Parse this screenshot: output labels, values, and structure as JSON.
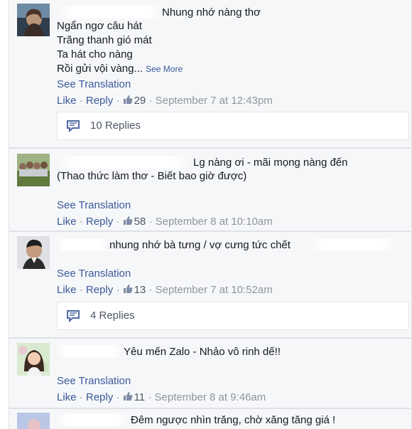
{
  "see_translation": "See Translation",
  "comments": [
    {
      "lines": [
        "Nhung nhớ nàng thơ",
        "Ngẩn ngơ câu hát",
        "Trăng thanh gió mát",
        "Ta hát cho nàng",
        "Rồi gửi vội vàng..."
      ],
      "see_more": "See More",
      "like": "Like",
      "reply": "Reply",
      "likes": "29",
      "time": "September 7 at 12:43pm",
      "replies": "10 Replies"
    },
    {
      "lines": [
        "Lg nàng ơi - mãi mọng nàng đến",
        "(Thao thức làm thơ - Biết bao giờ được)"
      ],
      "like": "Like",
      "reply": "Reply",
      "likes": "58",
      "time": "September 8 at 10:10am"
    },
    {
      "lines": [
        "nhung nhớ bà tưng / vợ cưng tức chết"
      ],
      "like": "Like",
      "reply": "Reply",
      "likes": "13",
      "time": "September 7 at 10:52am",
      "replies": "4 Replies"
    },
    {
      "lines": [
        "Yêu mến Zalo - Nhảo vô rinh dế!!"
      ],
      "like": "Like",
      "reply": "Reply",
      "likes": "11",
      "time": "September 8 at 9:46am"
    },
    {
      "lines": [
        "Đêm ngược nhìn trăng, chờ xăng tăng giá !"
      ]
    }
  ],
  "colors": {
    "link": "#3b5998",
    "meta": "#90949c",
    "panel": "#f6f7f9"
  }
}
